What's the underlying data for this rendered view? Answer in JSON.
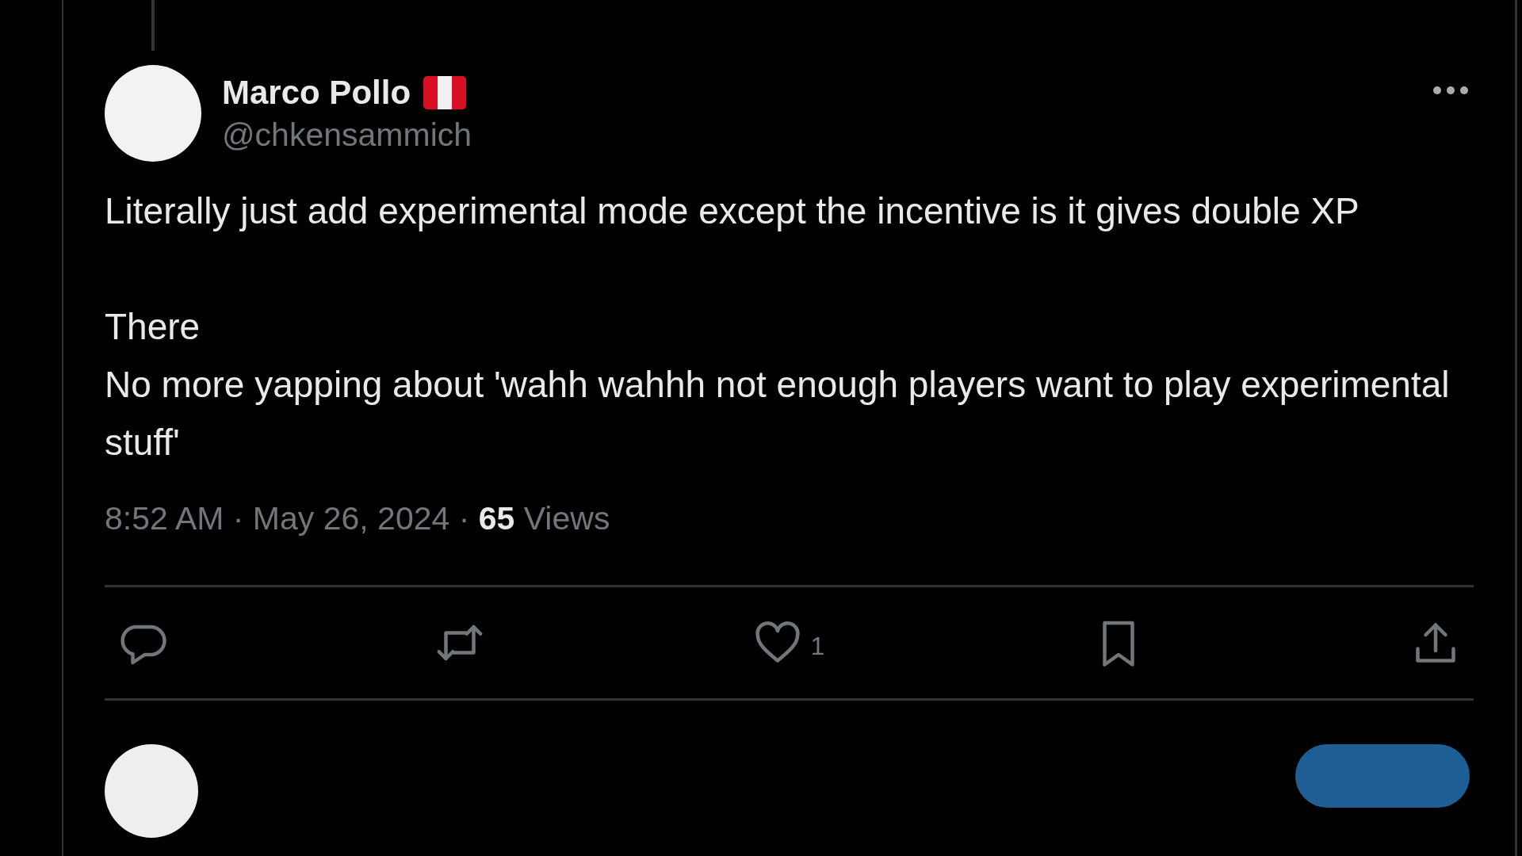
{
  "author": {
    "name": "Marco Pollo",
    "handle": "@chkensammich"
  },
  "body": "Literally just add experimental mode except the incentive is it gives double XP\n\nThere\nNo more yapping about 'wahh wahhh not enough players want to play experimental stuff'",
  "meta": "8:52 AM · May 26, 2024 · **65** Views",
  "actions": [
    {
      "kind": "reply"
    },
    {
      "kind": "repost"
    },
    {
      "kind": "like",
      "count": "1"
    },
    {
      "kind": "bookmark"
    },
    {
      "kind": "share"
    }
  ]
}
